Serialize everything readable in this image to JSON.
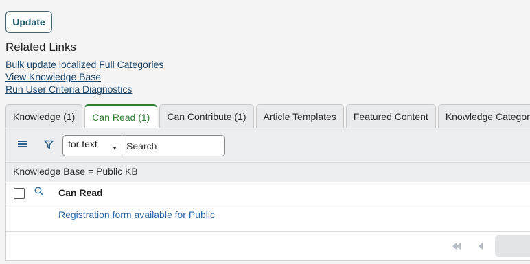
{
  "update_label": "Update",
  "related_links": {
    "heading": "Related Links",
    "items": [
      "Bulk update localized Full Categories",
      "View Knowledge Base",
      "Run User Criteria Diagnostics"
    ]
  },
  "tabs": [
    {
      "label": "Knowledge (1)",
      "active": false
    },
    {
      "label": "Can Read (1)",
      "active": true
    },
    {
      "label": "Can Contribute (1)",
      "active": false
    },
    {
      "label": "Article Templates",
      "active": false
    },
    {
      "label": "Featured Content",
      "active": false
    },
    {
      "label": "Knowledge Categories",
      "active": false
    }
  ],
  "toolbar": {
    "filter_select": "for text",
    "search_placeholder": "Search",
    "icons": [
      "hamburger-icon",
      "filter-icon"
    ]
  },
  "breadcrumb": "Knowledge Base = Public KB",
  "table": {
    "column": "Can Read",
    "rows": [
      "Registration form available for Public"
    ]
  },
  "colors": {
    "accent_green": "#2e7d32",
    "link_blue": "#2866a8",
    "update_border": "#3f6673"
  }
}
